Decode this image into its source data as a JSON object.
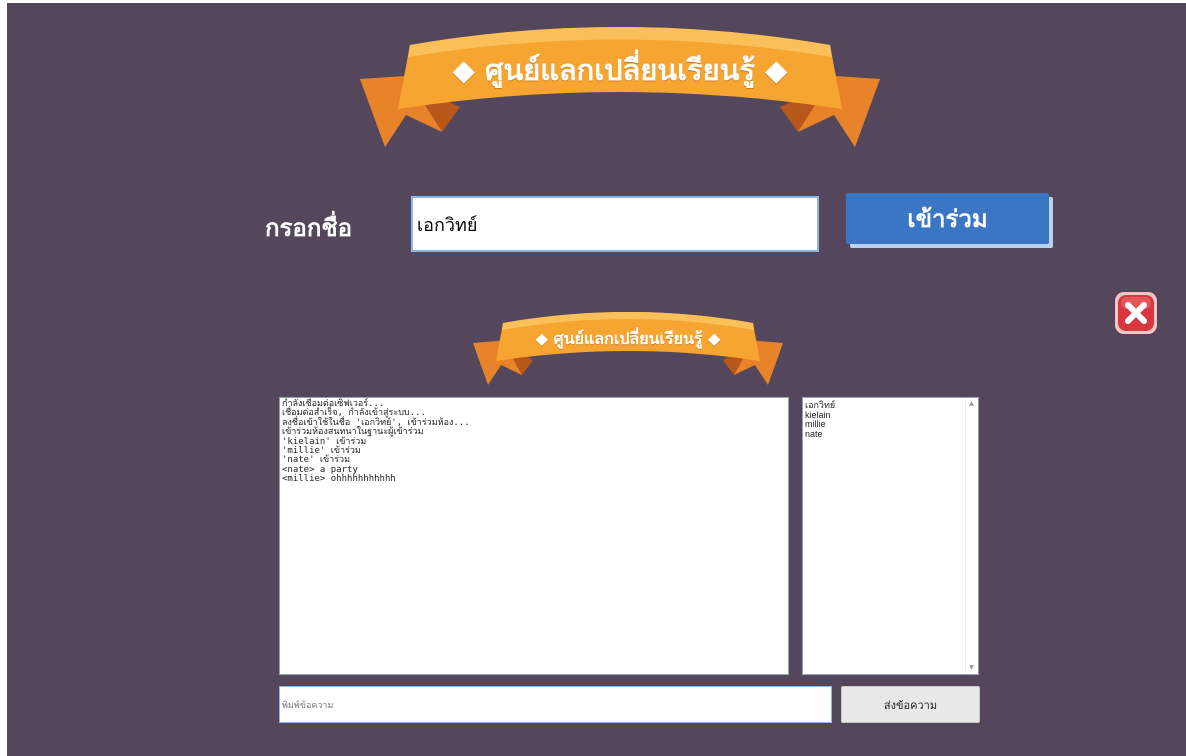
{
  "banner": {
    "title": "◆ ศูนย์แลกเปลี่ยนเรียนรู้ ◆"
  },
  "login": {
    "name_label": "กรอกชื่อ",
    "name_value": "เอกวิทย์",
    "join_label": "เข้าร่วม"
  },
  "chat": {
    "banner_title": "◆ ศูนย์แลกเปลี่ยนเรียนรู้ ◆",
    "log": [
      "กำลังเชื่อมต่อเซิฟเวอร์...",
      "เชื่อมต่อสำเร็จ, กำลังเข้าสู่ระบบ...",
      "ลงชื่อเข้าใช้ในชื่อ 'เอกวิทย์', เข้าร่วมห้อง...",
      "เข้าร่วมห้องสนทนาในฐานะผู้เข้าร่วม",
      "'kielain' เข้าร่วม",
      "'millie' เข้าร่วม",
      "'nate' เข้าร่วม",
      "<nate> a party",
      "<millie> ohhhhhhhhhhh"
    ],
    "users": [
      "เอกวิทย์",
      "kielain",
      "millie",
      "nate"
    ],
    "message_placeholder": "พิมพ์ข้อความ",
    "send_label": "ส่งข้อความ"
  },
  "icons": {
    "close": "close-icon",
    "scroll_up": "scroll-up-arrow-icon",
    "scroll_down": "scroll-down-arrow-icon"
  },
  "colors": {
    "background": "#54475c",
    "ribbon": "#f29b2e",
    "join_button": "#3b76c4",
    "close_button": "#d9363e"
  }
}
